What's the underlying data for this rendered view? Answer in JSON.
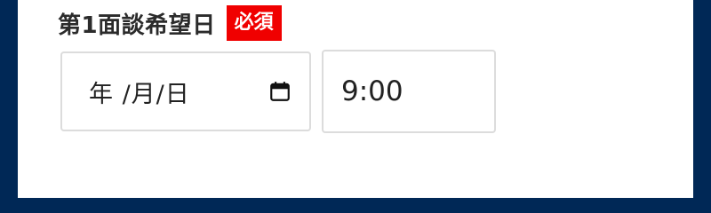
{
  "field": {
    "label": "第1面談希望日",
    "required_badge": "必須",
    "date_placeholder": "年 /月/日",
    "time_value": "9:00"
  },
  "icons": {
    "calendar": "calendar-icon"
  },
  "colors": {
    "frame": "#002856",
    "required": "#f00000",
    "input_border": "#dcdcdc"
  }
}
